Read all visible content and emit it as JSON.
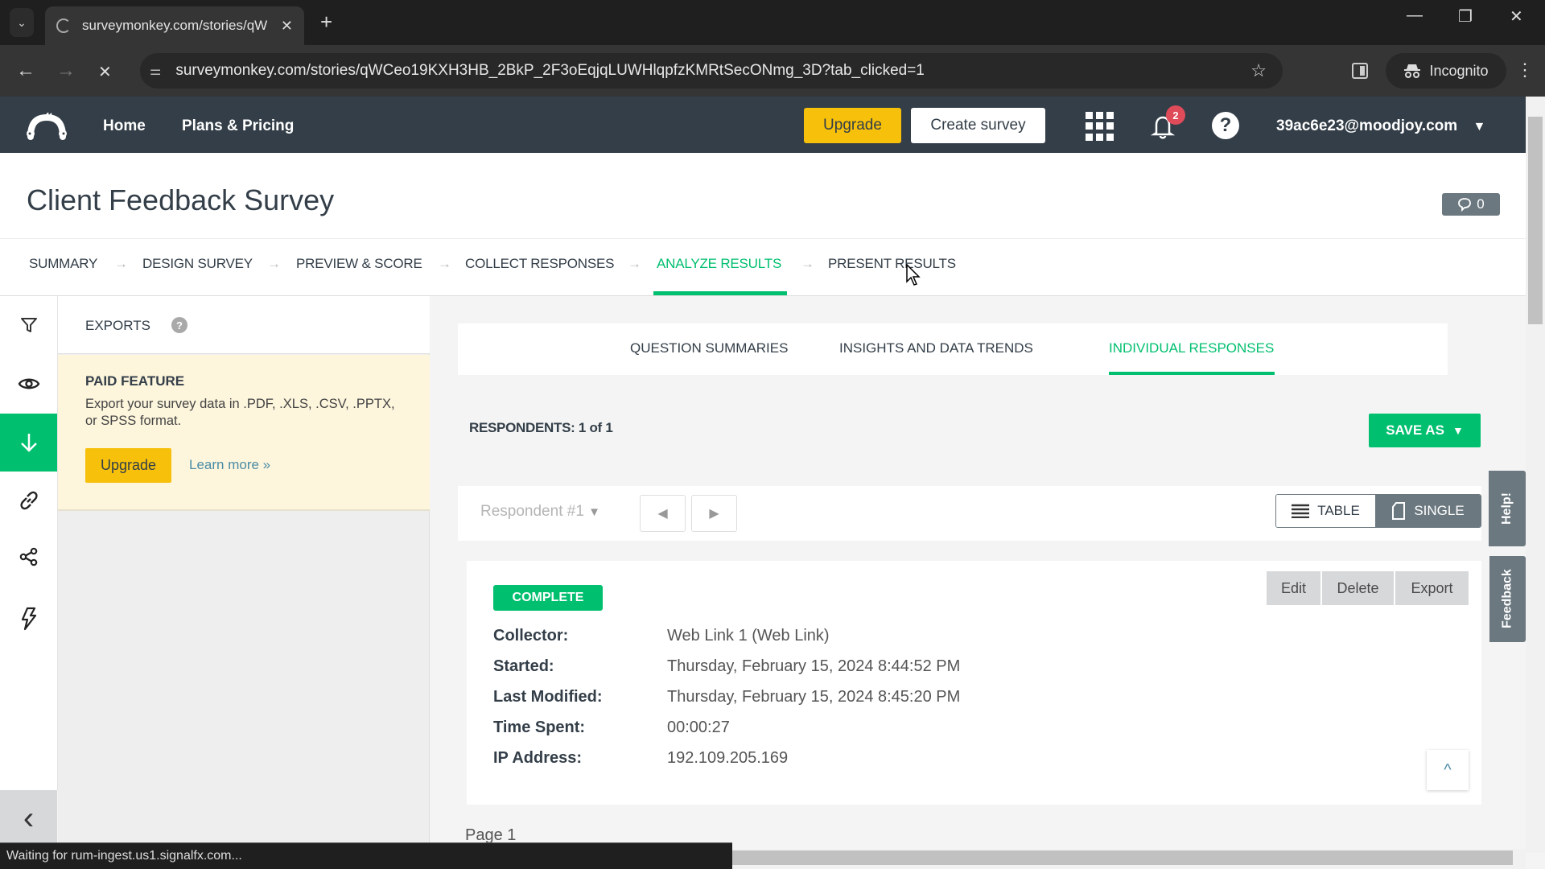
{
  "browser": {
    "tab_title": "surveymonkey.com/stories/qW",
    "url": "surveymonkey.com/stories/qWCeo19KXH3HB_2BkP_2F3oEqjqLUWHlqpfzKMRtSecONmg_3D?tab_clicked=1",
    "incognito_label": "Incognito",
    "status_text": "Waiting for rum-ingest.us1.signalfx.com...",
    "icons": {
      "tab_list": "chevron-down-icon",
      "new_tab": "+",
      "back": "←",
      "forward": "→",
      "stop": "✕",
      "star": "☆",
      "menu": "⋮",
      "minimize": "—",
      "restore": "❐",
      "close": "✕"
    }
  },
  "app_header": {
    "nav": [
      {
        "label": "Home"
      },
      {
        "label": "Plans & Pricing"
      }
    ],
    "upgrade_label": "Upgrade",
    "create_survey_label": "Create survey",
    "notification_count": "2",
    "help_glyph": "?",
    "user_email": "39ac6e23@moodjoy.com",
    "user_menu_caret": "▼"
  },
  "survey": {
    "title": "Client Feedback Survey",
    "comment_count": "0"
  },
  "steps": [
    {
      "label": "SUMMARY",
      "active": false
    },
    {
      "label": "DESIGN SURVEY",
      "active": false
    },
    {
      "label": "PREVIEW & SCORE",
      "active": false
    },
    {
      "label": "COLLECT RESPONSES",
      "active": false
    },
    {
      "label": "ANALYZE RESULTS",
      "active": true
    },
    {
      "label": "PRESENT RESULTS",
      "active": false
    }
  ],
  "step_arrow": "→",
  "rail": {
    "items": [
      {
        "name": "filter",
        "icon": "filter-icon"
      },
      {
        "name": "view",
        "icon": "eye-icon"
      },
      {
        "name": "exports",
        "icon": "download-icon",
        "active": true
      },
      {
        "name": "shared-links",
        "icon": "link-icon"
      },
      {
        "name": "share",
        "icon": "share-icon"
      },
      {
        "name": "integrations",
        "icon": "lightning-icon"
      }
    ],
    "collapse_glyph": "‹"
  },
  "exports_panel": {
    "title": "EXPORTS",
    "help_glyph": "?",
    "paid_feature": {
      "title": "PAID FEATURE",
      "description": "Export your survey data in .PDF, .XLS, .CSV, .PPTX, or SPSS format.",
      "upgrade_label": "Upgrade",
      "learn_more_label": "Learn more »"
    }
  },
  "analyze": {
    "tabs": [
      {
        "label": "QUESTION SUMMARIES",
        "active": false
      },
      {
        "label": "INSIGHTS AND DATA TRENDS",
        "active": false
      },
      {
        "label": "INDIVIDUAL RESPONSES",
        "active": true
      }
    ],
    "respondents_label": "RESPONDENTS: 1 of 1",
    "save_as_label": "SAVE AS",
    "save_as_caret": "▼",
    "respondent_select": "Respondent #1",
    "prev_glyph": "◀",
    "next_glyph": "▶",
    "view_table_label": "TABLE",
    "view_single_label": "SINGLE",
    "active_view": "SINGLE"
  },
  "response": {
    "status": "COMPLETE",
    "actions": [
      {
        "label": "Edit"
      },
      {
        "label": "Delete"
      },
      {
        "label": "Export"
      }
    ],
    "meta": [
      {
        "label": "Collector:",
        "value": "Web Link 1 (Web Link)"
      },
      {
        "label": "Started:",
        "value": "Thursday, February 15, 2024 8:44:52 PM"
      },
      {
        "label": "Last Modified:",
        "value": "Thursday, February 15, 2024 8:45:20 PM"
      },
      {
        "label": "Time Spent:",
        "value": "00:00:27"
      },
      {
        "label": "IP Address:",
        "value": "192.109.205.169"
      }
    ],
    "scroll_top_glyph": "^",
    "page_label": "Page 1"
  },
  "side_tabs": {
    "help_label": "Help!",
    "feedback_label": "Feedback"
  },
  "colors": {
    "brand_green": "#00bf6f",
    "upgrade_yellow": "#f6c00b",
    "header_dark": "#333e48",
    "paid_feature_bg": "#fdf5dc",
    "badge_red": "#e04b5a"
  }
}
